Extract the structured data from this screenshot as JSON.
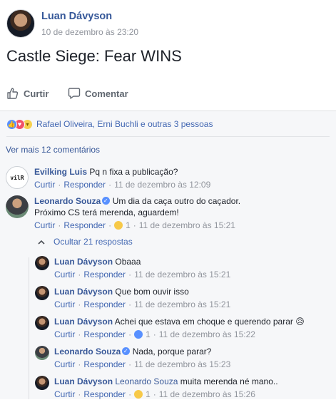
{
  "post": {
    "author": "Luan Dávyson",
    "timestamp": "10 de dezembro às 23:20",
    "text": "Castle Siege: Fear WINS"
  },
  "actions": {
    "like_label": "Curtir",
    "comment_label": "Comentar"
  },
  "reactions": {
    "summary": "Rafael Oliveira, Erni Buchli e outras 3 pessoas",
    "icons": [
      "like-icon",
      "love-icon",
      "haha-icon"
    ]
  },
  "more_comments": "Ver mais 12 comentários",
  "meta_labels": {
    "like": "Curtir",
    "reply": "Responder",
    "dot": "·"
  },
  "comments": [
    {
      "author": "Evilking Luis",
      "avatar_text": "vilR",
      "text": "Pq n fixa a publicação?",
      "time": "11 de dezembro às 12:09"
    },
    {
      "author": "Leonardo Souza",
      "text_line1": "Um dia da caça outro do caçador.",
      "text_line2": "Próximo CS terá merenda, aguardem!",
      "reaction_count": "1",
      "time": "11 de dezembro às 15:21"
    }
  ],
  "replies_toggle": "Ocultar 21 respostas",
  "replies": [
    {
      "author": "Luan Dávyson",
      "text": "Obaaa",
      "time": "11 de dezembro às 15:21"
    },
    {
      "author": "Luan Dávyson",
      "text": "Que bom ouvir isso",
      "time": "11 de dezembro às 15:21"
    },
    {
      "author": "Luan Dávyson",
      "text": "Achei que estava em choque e querendo parar",
      "emoji": "😥",
      "reaction_count": "1",
      "time": "11 de dezembro às 15:22"
    },
    {
      "author": "Leonardo Souza",
      "text": "Nada, porque parar?",
      "time": "11 de dezembro às 15:23"
    },
    {
      "author": "Luan Dávyson",
      "tag": "Leonardo Souza",
      "text": "muita merenda né mano..",
      "reaction_count": "1",
      "time": "11 de dezembro às 15:26"
    }
  ],
  "colors": {
    "link": "#385898",
    "meta": "#90949c",
    "like_blue": "#5890ff",
    "love_red": "#f25268",
    "haha_yellow": "#f7d14e"
  }
}
